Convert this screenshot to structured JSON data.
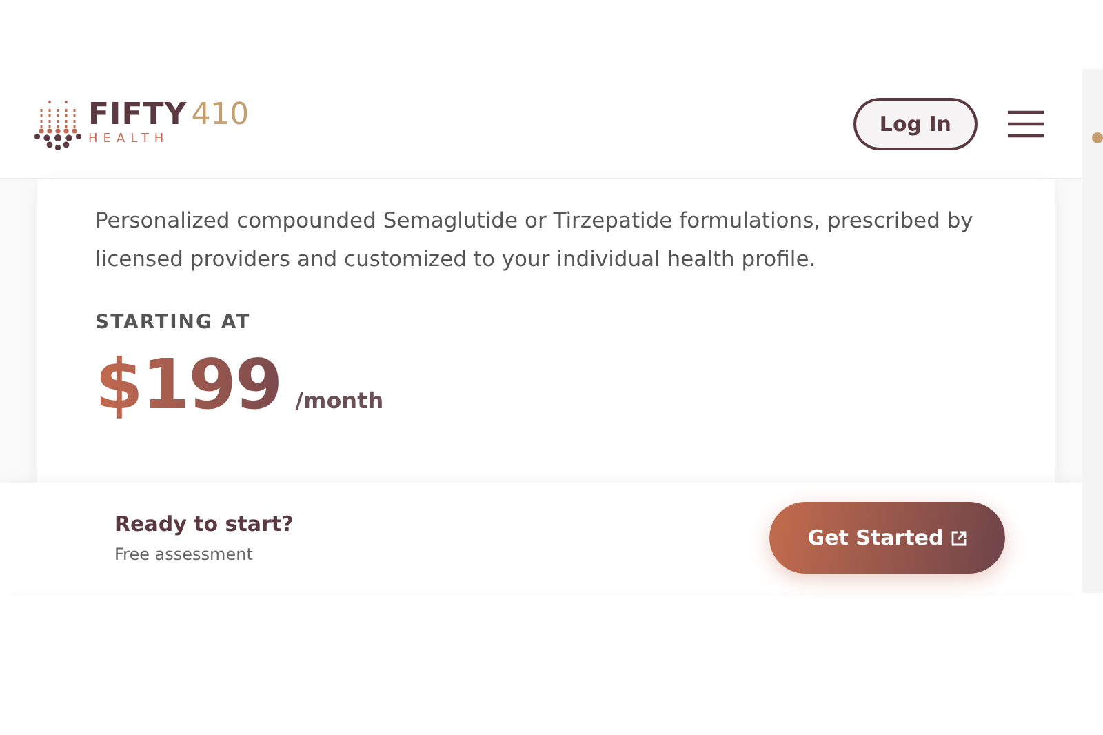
{
  "header": {
    "logo": {
      "name": "FIFTY",
      "number": "410",
      "tagline": "HEALTH"
    },
    "login": "Log In"
  },
  "card": {
    "description": "Personalized compounded Semaglutide or Tirzepatide formulations, prescribed by licensed providers and customized to your individual health profile.",
    "price_label": "STARTING AT",
    "price": "$199",
    "period": "/month"
  },
  "cta_bar": {
    "title": "Ready to start?",
    "subtitle": "Free assessment",
    "button": "Get Started"
  }
}
